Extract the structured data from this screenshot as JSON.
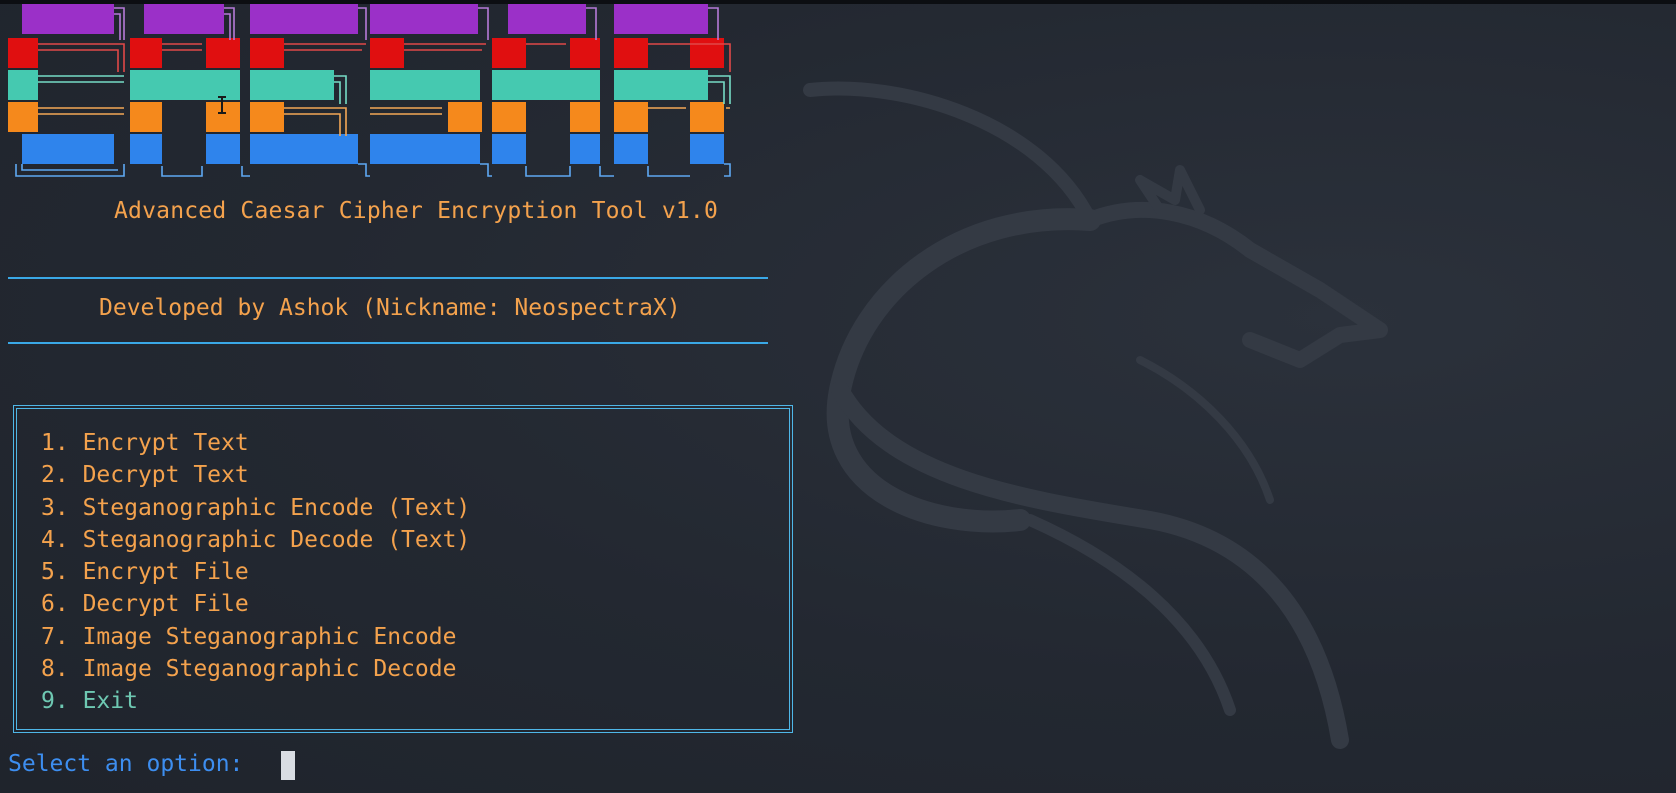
{
  "terminal": {
    "subtitle": "Advanced Caesar Cipher Encryption Tool v1.0",
    "developer": "Developed by Ashok (Nickname: NeospectraX)",
    "menu": [
      {
        "number": "1.",
        "label": "Encrypt Text"
      },
      {
        "number": "2.",
        "label": "Decrypt Text"
      },
      {
        "number": "3.",
        "label": "Steganographic Encode (Text)"
      },
      {
        "number": "4.",
        "label": "Steganographic Decode (Text)"
      },
      {
        "number": "5.",
        "label": "Encrypt File"
      },
      {
        "number": "6.",
        "label": "Decrypt File"
      },
      {
        "number": "7.",
        "label": "Image Steganographic Encode"
      },
      {
        "number": "8.",
        "label": "Image Steganographic Decode"
      },
      {
        "number": "9.",
        "label": "Exit"
      }
    ],
    "prompt": "Select an option: "
  },
  "colors": {
    "background": "#232831",
    "banner_purple": "#9b30c8",
    "banner_red": "#e00f10",
    "banner_teal": "#45c9b0",
    "banner_orange": "#f5891c",
    "banner_blue": "#2f84ec",
    "text_orange": "#f4a24d",
    "exit_teal": "#6ec8b2",
    "prompt_blue": "#3d8ef0",
    "rule_blue": "#3aa8e6"
  },
  "icons": [
    "kali-dragon-watermark-icon",
    "text-cursor-icon",
    "block-cursor-icon"
  ]
}
